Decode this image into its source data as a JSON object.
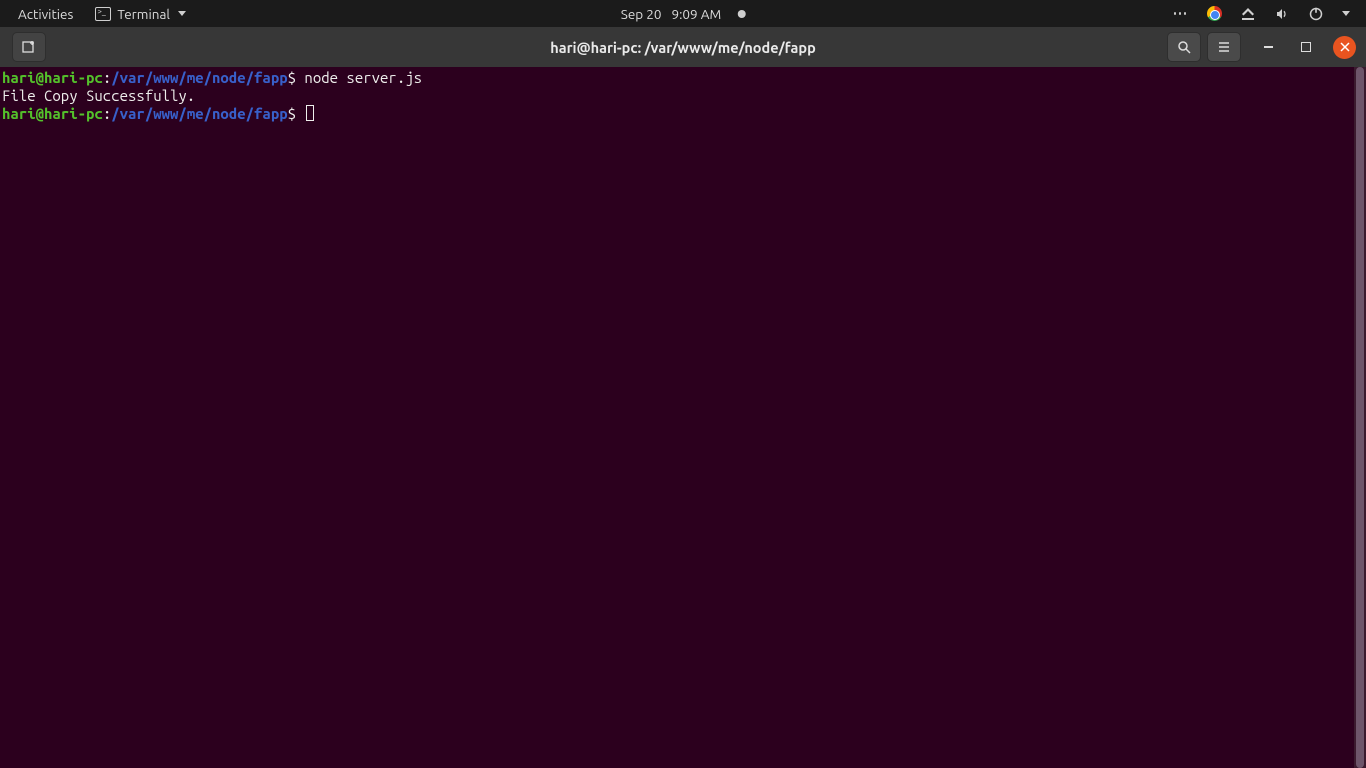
{
  "topbar": {
    "activities": "Activities",
    "app_name": "Terminal",
    "date": "Sep 20",
    "time": "9:09 AM"
  },
  "headerbar": {
    "title": "hari@hari-pc: /var/www/me/node/fapp"
  },
  "terminal": {
    "line1": {
      "user_host": "hari@hari-pc",
      "colon": ":",
      "path": "/var/www/me/node/fapp",
      "prompt": "$",
      "command": " node server.js"
    },
    "output": "File Copy Successfully.",
    "line2": {
      "user_host": "hari@hari-pc",
      "colon": ":",
      "path": "/var/www/me/node/fapp",
      "prompt": "$"
    }
  }
}
